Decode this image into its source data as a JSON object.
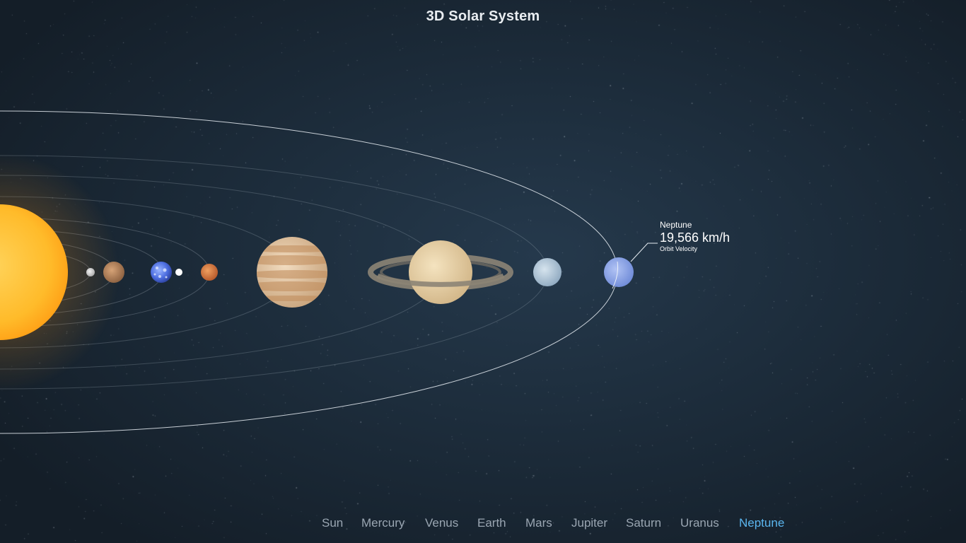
{
  "title": "3D Solar System",
  "nav": {
    "items": [
      {
        "label": "Sun",
        "slug": "sun"
      },
      {
        "label": "Mercury",
        "slug": "mercury"
      },
      {
        "label": "Venus",
        "slug": "venus"
      },
      {
        "label": "Earth",
        "slug": "earth"
      },
      {
        "label": "Mars",
        "slug": "mars"
      },
      {
        "label": "Jupiter",
        "slug": "jupiter"
      },
      {
        "label": "Saturn",
        "slug": "saturn"
      },
      {
        "label": "Uranus",
        "slug": "uranus"
      },
      {
        "label": "Neptune",
        "slug": "neptune"
      }
    ],
    "selected": "Neptune"
  },
  "callout": {
    "planet": "Neptune",
    "value": "19,566 km/h",
    "label": "Orbit Velocity"
  },
  "colors": {
    "accent": "#5bb6ef",
    "nav_text": "#9aa6b2",
    "title_text": "#e9edf1",
    "sun": "#ffb21f",
    "neptune": "#8aa3e0"
  }
}
